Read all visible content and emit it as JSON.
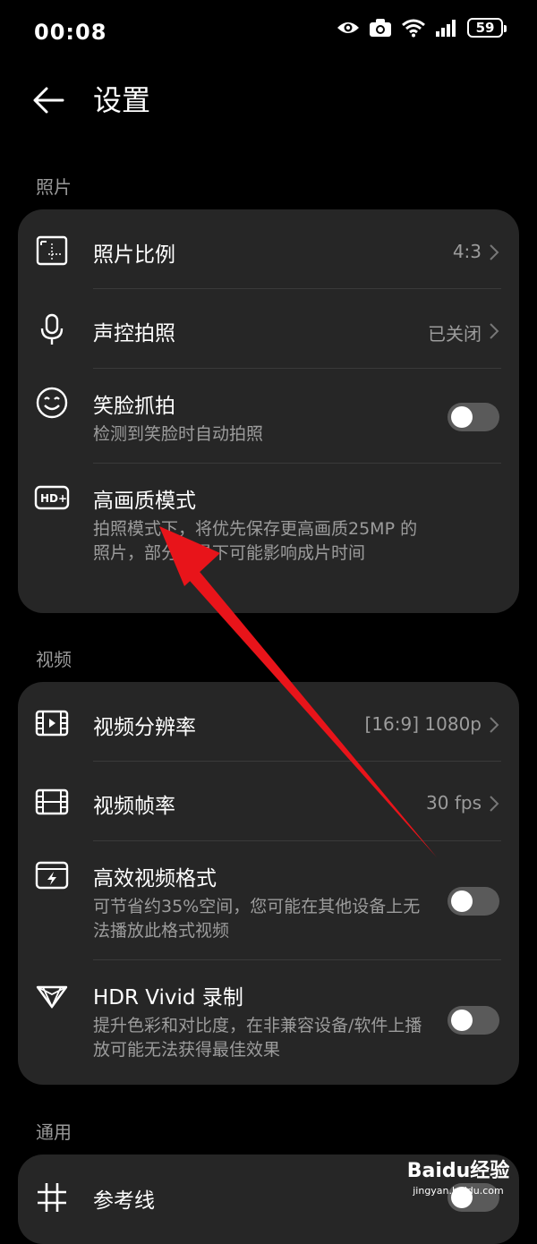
{
  "status_bar": {
    "time": "00:08",
    "battery": "59"
  },
  "header": {
    "title": "设置"
  },
  "sections": {
    "photo": {
      "label": "照片",
      "rows": [
        {
          "title": "照片比例",
          "value": "4:3"
        },
        {
          "title": "声控拍照",
          "value": "已关闭"
        },
        {
          "title": "笑脸抓拍",
          "subtitle": "检测到笑脸时自动拍照",
          "toggle": false
        },
        {
          "title": "高画质模式",
          "subtitle": "拍照模式下，将优先保存更高画质25MP 的照片，部分场景下可能影响成片时间",
          "toggle": false
        }
      ]
    },
    "video": {
      "label": "视频",
      "rows": [
        {
          "title": "视频分辨率",
          "value": "[16:9] 1080p"
        },
        {
          "title": "视频帧率",
          "value": "30 fps"
        },
        {
          "title": "高效视频格式",
          "subtitle": "可节省约35%空间，您可能在其他设备上无法播放此格式视频",
          "toggle": false
        },
        {
          "title": "HDR Vivid 录制",
          "subtitle": "提升色彩和对比度，在非兼容设备/软件上播放可能无法获得最佳效果",
          "toggle": false
        }
      ]
    },
    "general": {
      "label": "通用",
      "rows": [
        {
          "title": "参考线"
        }
      ]
    }
  },
  "watermark": {
    "main": "Baidu经验",
    "sub": "jingyan.baidu.com"
  },
  "colors": {
    "background": "#000000",
    "card": "#262626",
    "secondary_text": "#9c9c9c",
    "annotation_arrow": "#e8141a"
  },
  "icons": [
    "eye-icon",
    "camera-icon",
    "wifi-icon",
    "signal-icon",
    "battery-icon",
    "back-arrow-icon",
    "aspect-ratio-icon",
    "microphone-icon",
    "smile-icon",
    "hd-plus-icon",
    "video-resolution-icon",
    "film-frame-icon",
    "efficient-video-icon",
    "hdr-vivid-icon",
    "grid-lines-icon",
    "chevron-right-icon"
  ]
}
